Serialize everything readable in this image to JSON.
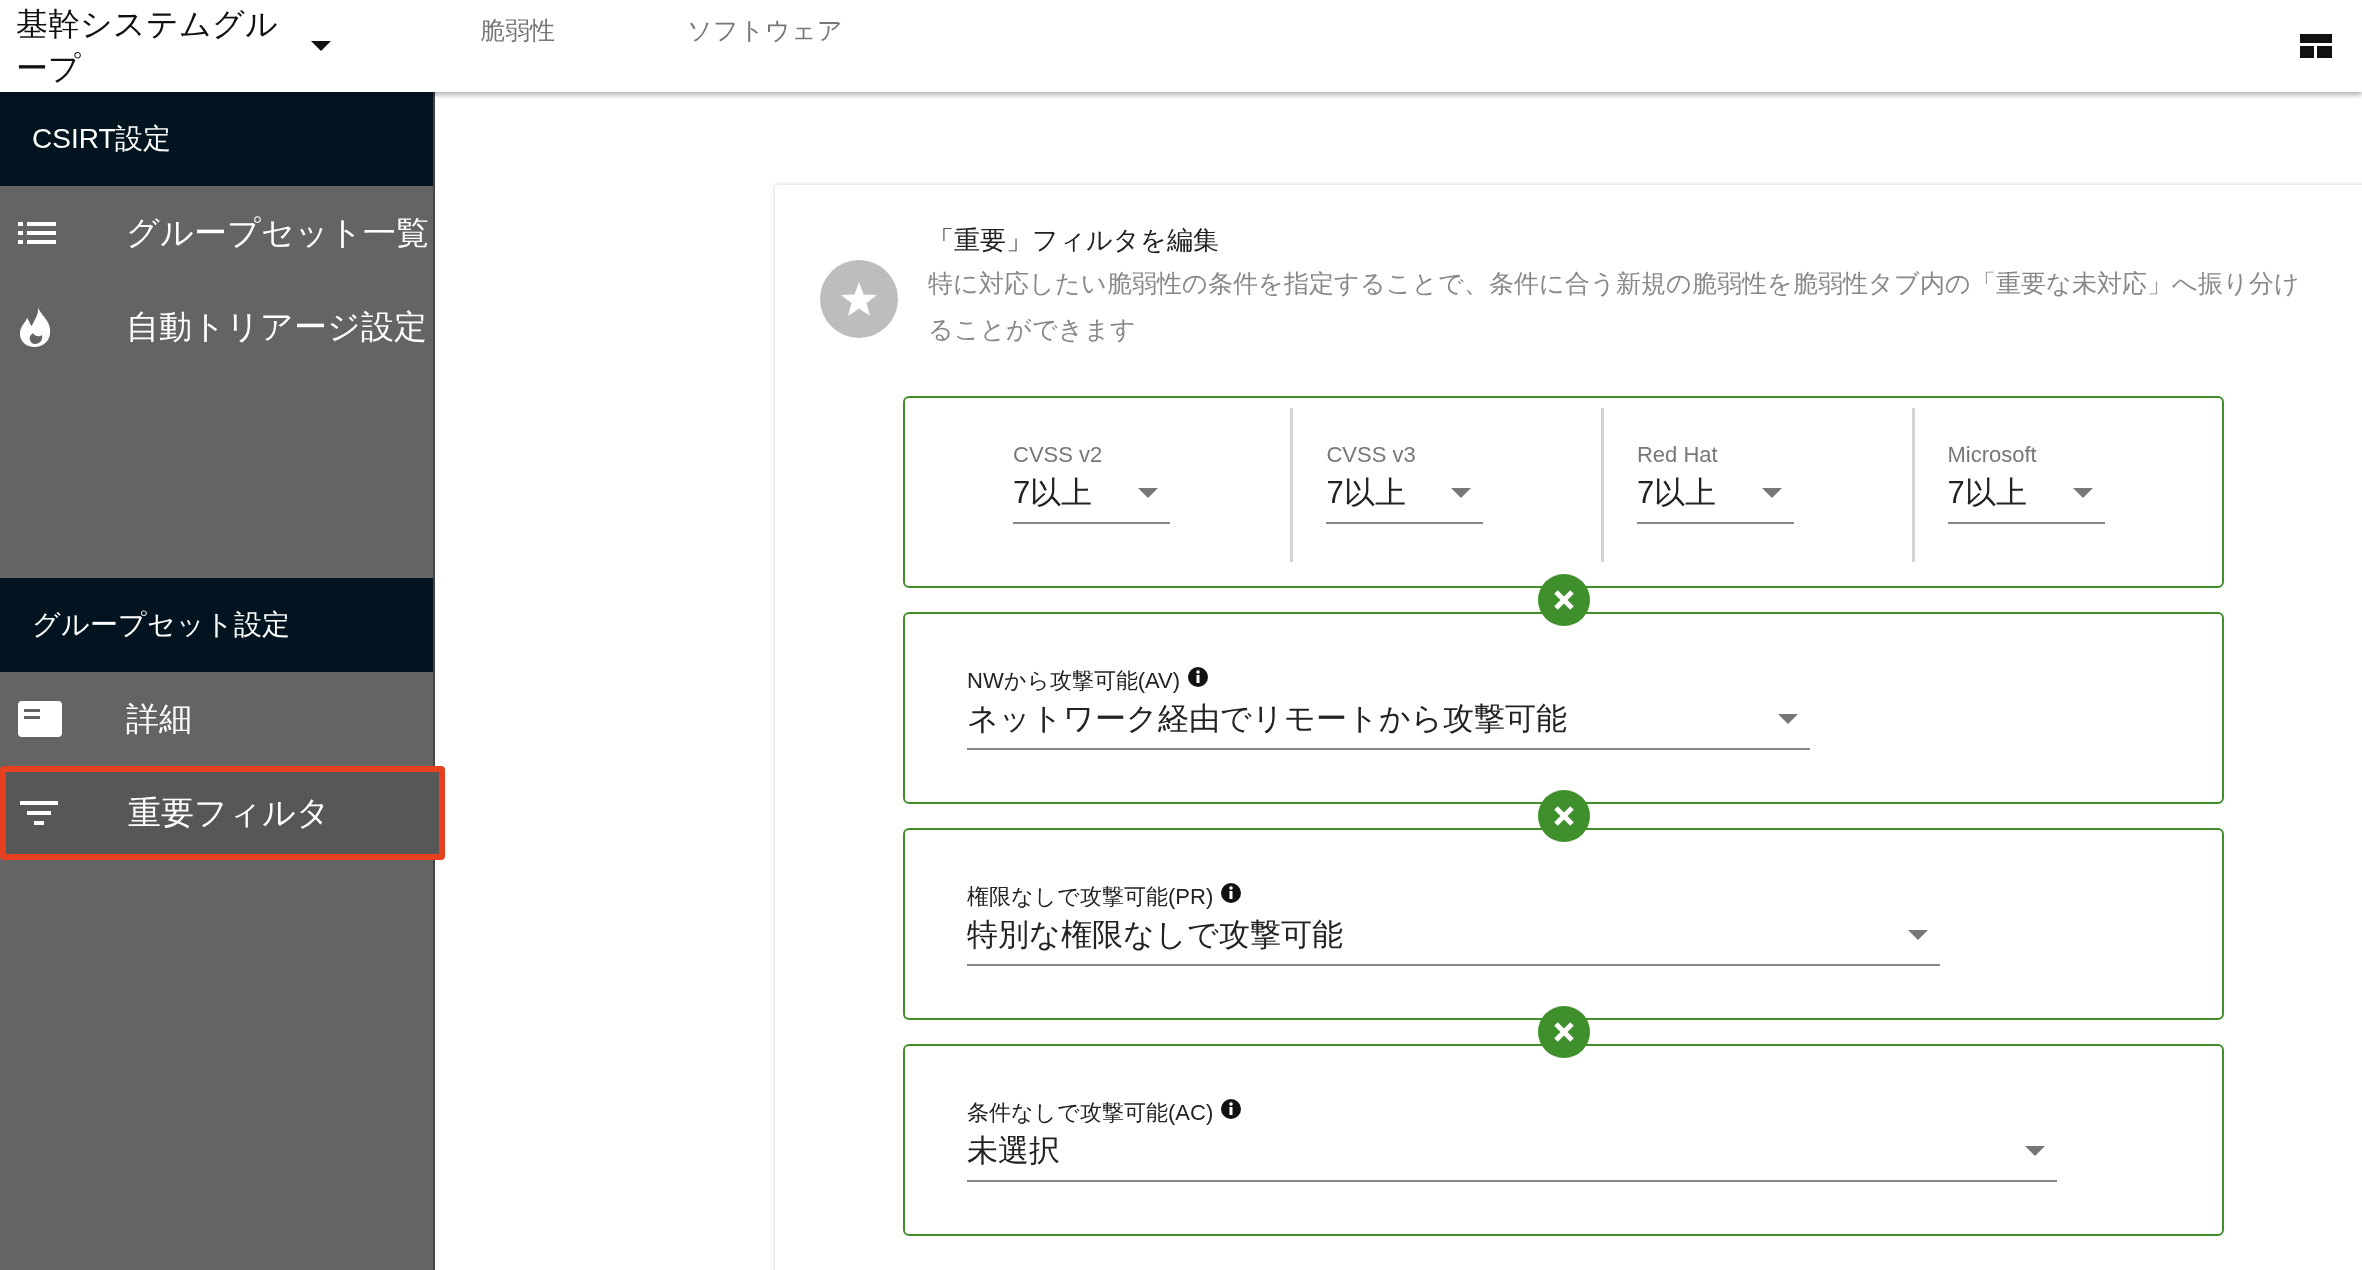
{
  "header": {
    "group": "基幹システムグループ",
    "tabs": [
      {
        "label": "脆弱性"
      },
      {
        "label": "ソフトウェア"
      }
    ]
  },
  "sidebar": {
    "sections": [
      {
        "title": "CSIRT設定",
        "items": [
          {
            "label": "グループセット一覧",
            "selected": false
          },
          {
            "label": "自動トリアージ設定",
            "selected": false
          }
        ]
      },
      {
        "title": "グループセット設定",
        "items": [
          {
            "label": "詳細",
            "selected": false
          },
          {
            "label": "重要フィルタ",
            "selected": true
          }
        ]
      }
    ]
  },
  "editor": {
    "title": "「重要」フィルタを編集",
    "description": "特に対応したい脆弱性の条件を指定することで、条件に合う新規の脆弱性を脆弱性タブ内の「重要な未対応」へ振り分けることができます",
    "filters": [
      {
        "kind": "scores",
        "scores": [
          {
            "label": "CVSS v2",
            "value": "7以上"
          },
          {
            "label": "CVSS v3",
            "value": "7以上"
          },
          {
            "label": "Red Hat",
            "value": "7以上"
          },
          {
            "label": "Microsoft",
            "value": "7以上"
          }
        ]
      },
      {
        "kind": "select",
        "label": "NWから攻撃可能(AV)",
        "value": "ネットワーク経由でリモートから攻撃可能"
      },
      {
        "kind": "select",
        "label": "権限なしで攻撃可能(PR)",
        "value": "特別な権限なしで攻撃可能"
      },
      {
        "kind": "select",
        "label": "条件なしで攻撃可能(AC)",
        "value": "未選択"
      }
    ]
  }
}
